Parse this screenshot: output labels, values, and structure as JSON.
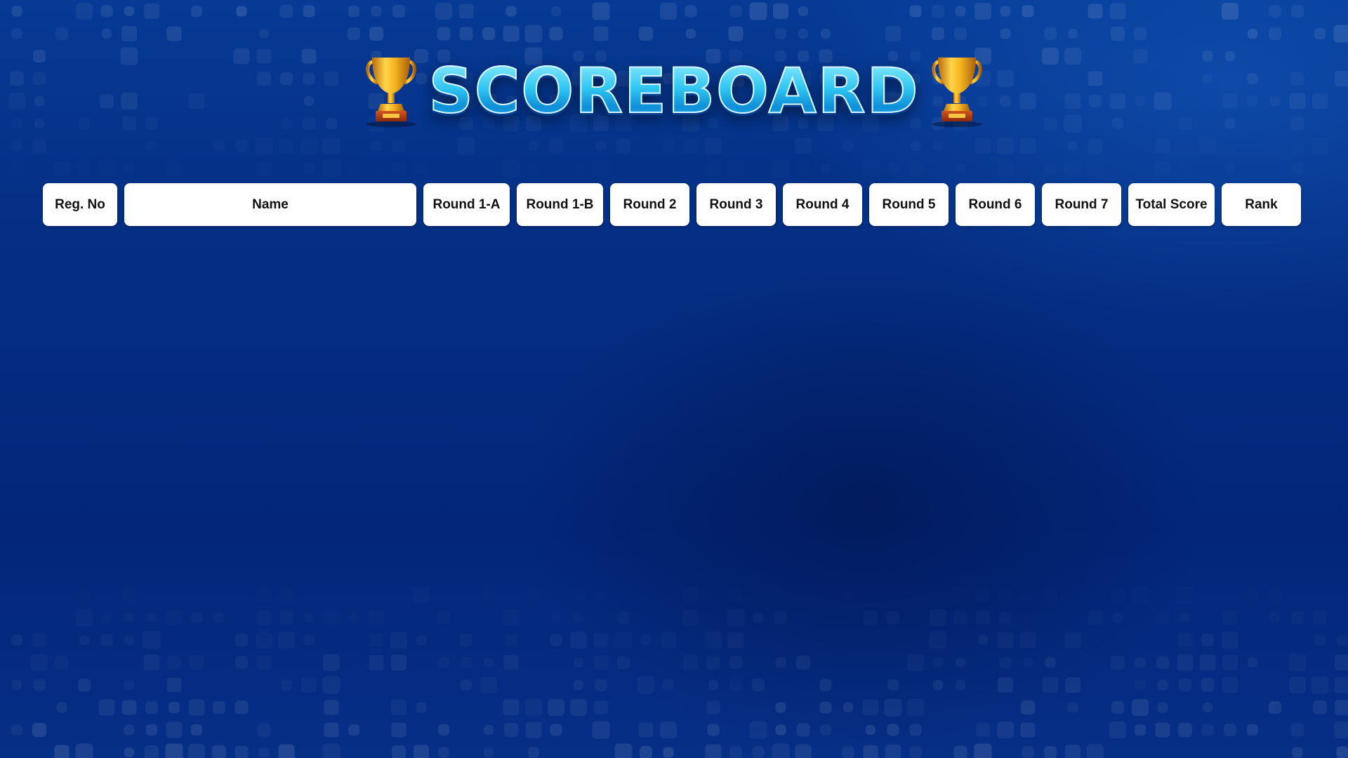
{
  "title": "SCOREBOARD",
  "icons": {
    "left": "trophy-icon",
    "right": "trophy-icon"
  },
  "colors": {
    "background": "#052f84",
    "title": "#2cc4ef",
    "header_cell": "#ffffff",
    "header_text": "#111111",
    "trophy_gold": "#f2b322"
  },
  "table": {
    "columns": [
      "Reg. No",
      "Name",
      "Round 1-A",
      "Round 1-B",
      "Round 2",
      "Round 3",
      "Round 4",
      "Round 5",
      "Round 6",
      "Round 7",
      "Total Score",
      "Rank"
    ],
    "rows": []
  }
}
